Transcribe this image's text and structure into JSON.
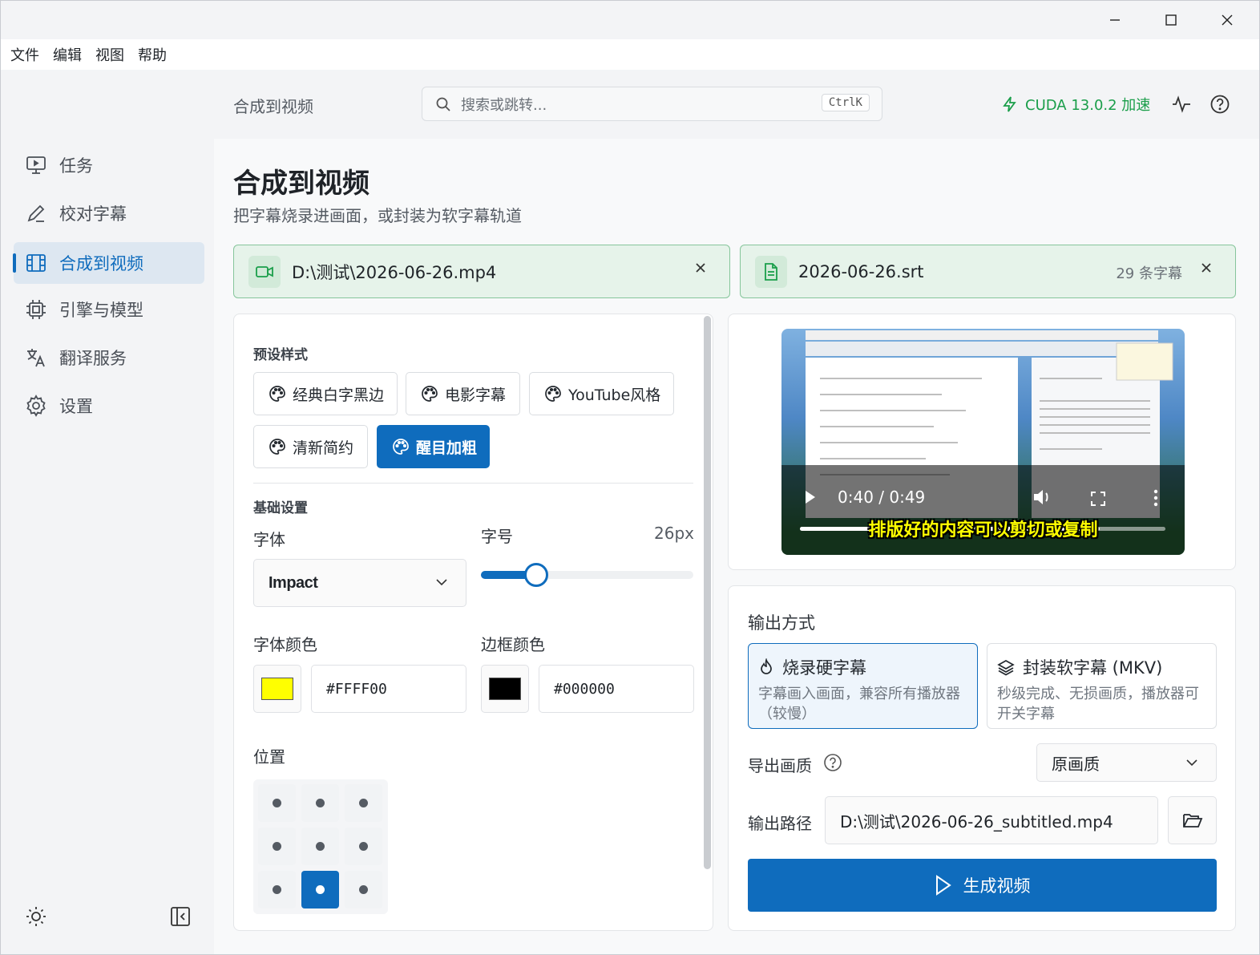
{
  "window": {
    "controls": [
      "minimize-icon",
      "maximize-icon",
      "close-icon"
    ]
  },
  "menubar": {
    "items": [
      "文件",
      "编辑",
      "视图",
      "帮助"
    ]
  },
  "sidebar": {
    "items": [
      {
        "label": "任务",
        "icon": "monitor-icon"
      },
      {
        "label": "校对字幕",
        "icon": "pen-icon"
      },
      {
        "label": "合成到视频",
        "icon": "film-icon",
        "active": true
      },
      {
        "label": "引擎与模型",
        "icon": "chip-icon"
      },
      {
        "label": "翻译服务",
        "icon": "translate-icon"
      },
      {
        "label": "设置",
        "icon": "gear-icon"
      }
    ]
  },
  "topbar": {
    "breadcrumb": "合成到视频",
    "search_placeholder": "搜索或跳转...",
    "shortcut": "CtrlK",
    "cuda": "CUDA 13.0.2 加速",
    "accent": "#0f6cbd",
    "success": "#1a9e4a"
  },
  "page": {
    "title": "合成到视频",
    "subtitle": "把字幕烧录进画面，或封装为软字幕轨道"
  },
  "files": {
    "video": "D:\\测试\\2026-06-26.mp4",
    "subtitle": "2026-06-26.srt",
    "subtitle_count": "29 条字幕"
  },
  "style": {
    "presets_label": "预设样式",
    "presets": [
      "经典白字黑边",
      "电影字幕",
      "YouTube风格",
      "清新简约",
      "醒目加粗"
    ],
    "selected_preset": "醒目加粗",
    "basic_label": "基础设置",
    "font_label": "字体",
    "font_value": "Impact",
    "size_label": "字号",
    "size_value": "26px",
    "size_fraction": 0.26,
    "font_color_label": "字体颜色",
    "font_color": "#FFFF00",
    "border_color_label": "边框颜色",
    "border_color": "#000000",
    "position_label": "位置",
    "position_selected": "bottom-center"
  },
  "preview": {
    "time": "0:40 / 0:49",
    "caption": "排版好的内容可以剪切或复制",
    "progress": 0.82
  },
  "output": {
    "mode_label": "输出方式",
    "modes": [
      {
        "title": "烧录硬字幕",
        "desc": "字幕画入画面，兼容所有播放器（较慢）",
        "icon": "flame-icon"
      },
      {
        "title": "封装软字幕 (MKV)",
        "desc": "秒级完成、无损画质，播放器可开关字幕",
        "icon": "layers-icon"
      }
    ],
    "quality_label": "导出画质",
    "quality_value": "原画质",
    "path_label": "输出路径",
    "path_value": "D:\\测试\\2026-06-26_subtitled.mp4",
    "generate_label": "生成视频"
  }
}
